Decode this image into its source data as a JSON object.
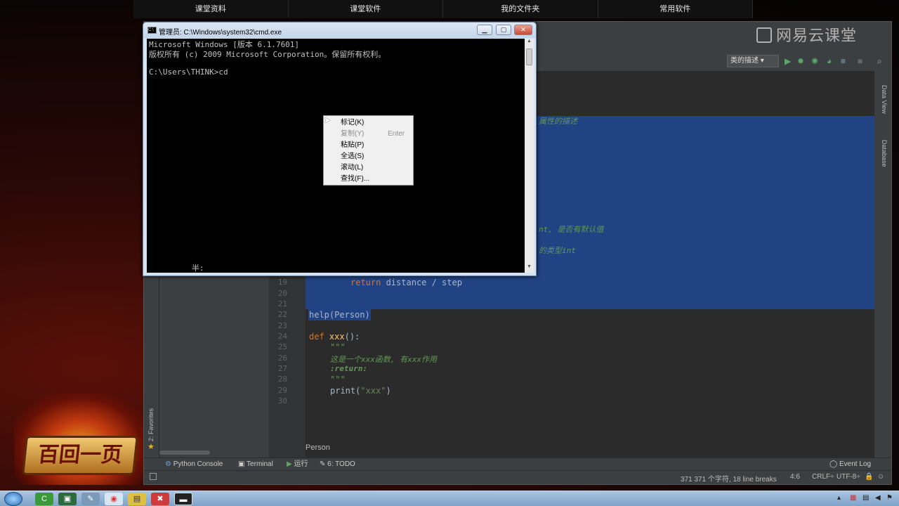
{
  "course_nav": {
    "tabs": [
      "课堂资料",
      "课堂软件",
      "我的文件夹",
      "常用软件"
    ]
  },
  "watermark": "网易云课堂",
  "ide": {
    "run_config": "类的描述",
    "right_panel": [
      "Data View",
      "Database"
    ],
    "favorites": "2: Favorites",
    "code": {
      "visible_comment_1": "属性的描述",
      "visible_comment_2": "nt, 是否有默认值",
      "visible_comment_3": "的类型int",
      "line19": "return distance / step",
      "line22": "help(Person)",
      "line24_kw": "def ",
      "line24_fn": "xxx",
      "line24_rest": "():",
      "line25": "\"\"\"",
      "line26": "这是一个xxx函数, 有xxx作用",
      "line27": ":return:",
      "line28": "\"\"\"",
      "line29_a": "print(",
      "line29_str": "\"xxx\"",
      "line29_b": ")",
      "line_numbers": [
        "19",
        "20",
        "21",
        "22",
        "23",
        "24",
        "25",
        "26",
        "27",
        "28",
        "29",
        "30"
      ]
    },
    "breadcrumb": "Person",
    "tool_tabs": [
      "Python Console",
      "Terminal",
      "运行",
      "6: TODO",
      "Event Log"
    ],
    "status": {
      "chars": "371 371 个字符, 18 line breaks",
      "position": "4:6",
      "line_sep": "CRLF÷",
      "encoding": "UTF-8÷"
    }
  },
  "cmd": {
    "title": "管理员: C:\\Windows\\system32\\cmd.exe",
    "lines": [
      "Microsoft Windows [版本 6.1.7601]",
      "版权所有 (c) 2009 Microsoft Corporation。保留所有权利。",
      "",
      "C:\\Users\\THINK>cd"
    ],
    "ime": "半:",
    "menu": [
      {
        "label": "标记(K)",
        "shortcut": "",
        "disabled": false
      },
      {
        "label": "复制(Y)",
        "shortcut": "Enter",
        "disabled": true
      },
      {
        "label": "粘贴(P)",
        "shortcut": "",
        "disabled": false
      },
      {
        "label": "全选(S)",
        "shortcut": "",
        "disabled": false
      },
      {
        "label": "滚动(L)",
        "shortcut": "",
        "disabled": false
      },
      {
        "label": "查找(F)...",
        "shortcut": "",
        "disabled": false
      }
    ]
  },
  "taskbar": {
    "apps": [
      "C",
      "▣",
      "✎",
      "◉",
      "▤",
      "✖",
      "▬"
    ]
  },
  "colors": {
    "selection": "#214283",
    "editor_bg": "#2b2b2b",
    "keyword": "#cc7832",
    "docstring": "#629755"
  }
}
